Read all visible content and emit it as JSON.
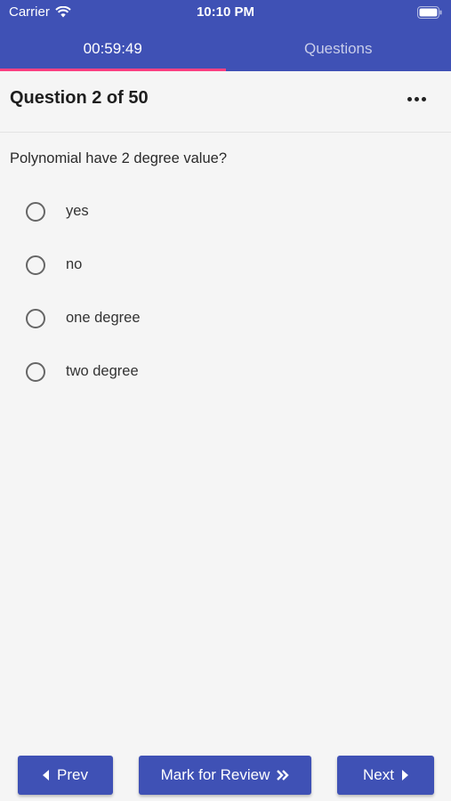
{
  "status_bar": {
    "carrier": "Carrier",
    "time": "10:10 PM"
  },
  "tabs": [
    {
      "label": "00:59:49",
      "active": true
    },
    {
      "label": "Questions",
      "active": false
    }
  ],
  "question": {
    "header": "Question 2 of 50",
    "text": "Polynomial have 2 degree value?",
    "options": [
      "yes",
      "no",
      "one degree",
      "two degree"
    ]
  },
  "footer": {
    "prev_label": "Prev",
    "review_label": "Mark for Review",
    "next_label": "Next"
  },
  "colors": {
    "primary": "#3f51b5",
    "tab_indicator": "#ff4081",
    "background": "#f5f5f5"
  }
}
